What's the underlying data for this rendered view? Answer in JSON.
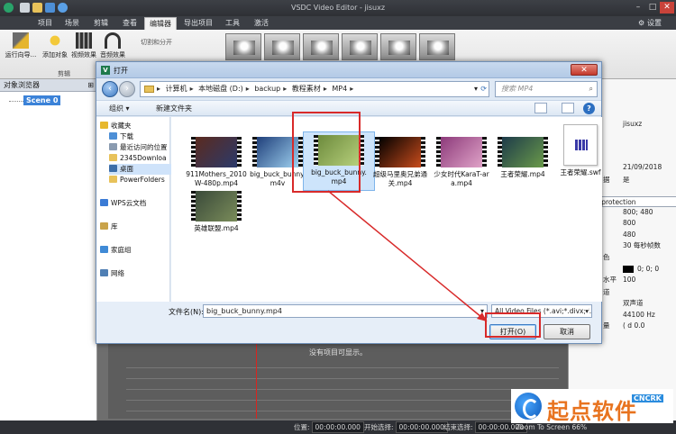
{
  "app": {
    "title": "VSDC Video Editor - jisuxz",
    "menu_tabs": [
      "项目",
      "场景",
      "剪辑",
      "查看",
      "编辑器",
      "导出项目",
      "工具",
      "激活"
    ],
    "active_tab": "编辑器",
    "settings_label": "设置",
    "ribbon": {
      "wizard_label": "运行向导...",
      "add_object_label": "添加对象",
      "video_effects_label": "视频效果",
      "audio_effects_label": "音频效果",
      "cut_split_label": "切割和分开",
      "group_label": "剪辑"
    }
  },
  "object_explorer": {
    "title": "对象浏览器",
    "scene_label": "Scene 0"
  },
  "timeline": {
    "empty_message": "没有项目可显示。"
  },
  "properties": {
    "rows": [
      {
        "key": "",
        "value": "jisuxz"
      },
      {
        "key": "",
        "value": "21/09/2018"
      },
      {
        "key": "据",
        "value": "是"
      },
      {
        "key": "",
        "value": "assword protection"
      },
      {
        "key": "",
        "value": "800; 480"
      },
      {
        "key": "",
        "value": "800"
      },
      {
        "key": "",
        "value": "480"
      },
      {
        "key": "",
        "value": "30 每秒帧数"
      },
      {
        "key": "色",
        "value": ""
      },
      {
        "key": "",
        "value": "0; 0; 0"
      },
      {
        "key": "水平",
        "value": "100"
      },
      {
        "key": "道",
        "value": ""
      },
      {
        "key": "",
        "value": "双声道"
      },
      {
        "key": "",
        "value": "44100 Hz"
      },
      {
        "key": "量",
        "value": "( d 0.0"
      }
    ]
  },
  "status_bar": {
    "pos_label": "位置:",
    "pos_value": "00:00:00.000",
    "start_label": "开始选择:",
    "start_value": "00:00:00.000",
    "end_label": "结束选择:",
    "end_value": "00:00:00.000",
    "zoom_label": "Zoom To Screen",
    "zoom_value": "66%"
  },
  "dialog": {
    "title": "打开",
    "close_label": "✕",
    "breadcrumb": [
      "计算机",
      "本地磁盘 (D:)",
      "backup",
      "教程素材",
      "MP4"
    ],
    "search_placeholder": "搜索 MP4",
    "organize_label": "组织 ▾",
    "new_folder_label": "新建文件夹",
    "nav": [
      {
        "label": "收藏夹",
        "icon": "star-icon",
        "color": "#e7b82e"
      },
      {
        "label": "下载",
        "icon": "download-folder-icon",
        "color": "#4d8fd6"
      },
      {
        "label": "最近访问的位置",
        "icon": "recent-icon",
        "color": "#8a9bb0"
      },
      {
        "label": "2345Downloa",
        "icon": "folder-icon",
        "color": "#e8c25a"
      },
      {
        "label": "桌面",
        "icon": "desktop-icon",
        "color": "#3d6ea8"
      },
      {
        "label": "PowerFolders",
        "icon": "folder-icon",
        "color": "#e8c25a"
      },
      {
        "label": "WPS云文档",
        "icon": "cloud-icon",
        "color": "#3a7bd5"
      },
      {
        "label": "库",
        "icon": "library-icon",
        "color": "#c9a34a"
      },
      {
        "label": "家庭组",
        "icon": "homegroup-icon",
        "color": "#3f8ad6"
      },
      {
        "label": "网络",
        "icon": "network-icon",
        "color": "#4f7fb4"
      }
    ],
    "files": [
      {
        "name": "911Mothers_2010W-480p.mp4",
        "thumb": "#5b2a1e",
        "thumb2": "#2b3a6b"
      },
      {
        "name": "big_buck_bunny.m4v",
        "thumb": "#1f3f7a",
        "thumb2": "#9fd1f0"
      },
      {
        "name": "big_buck_bunny.mp4",
        "thumb": "#6c8a3c",
        "thumb2": "#b7d07c"
      },
      {
        "name": "超级马里奥兄弟通关.mp4",
        "thumb": "#000000",
        "thumb2": "#c84c1c"
      },
      {
        "name": "少女时代KaraT-ara.mp4",
        "thumb": "#8c3a7a",
        "thumb2": "#e0a3c8"
      },
      {
        "name": "王者荣耀.mp4",
        "thumb": "#1d3b4a",
        "thumb2": "#6a9a4a"
      },
      {
        "name": "王者荣耀.swf",
        "thumb": "#ffffff",
        "thumb2": "#ffffff"
      },
      {
        "name": "英雄联盟.mp4",
        "thumb": "#3a4a3a",
        "thumb2": "#7a8c5a"
      }
    ],
    "filename_label": "文件名(N):",
    "filename_value": "big_buck_bunny.mp4",
    "filetype_value": "All Video Files (*.avi;*.divx;*.x",
    "open_label": "打开(O)",
    "cancel_label": "取消"
  },
  "watermark": {
    "text": "起点软件",
    "sub": "CNCRK"
  }
}
